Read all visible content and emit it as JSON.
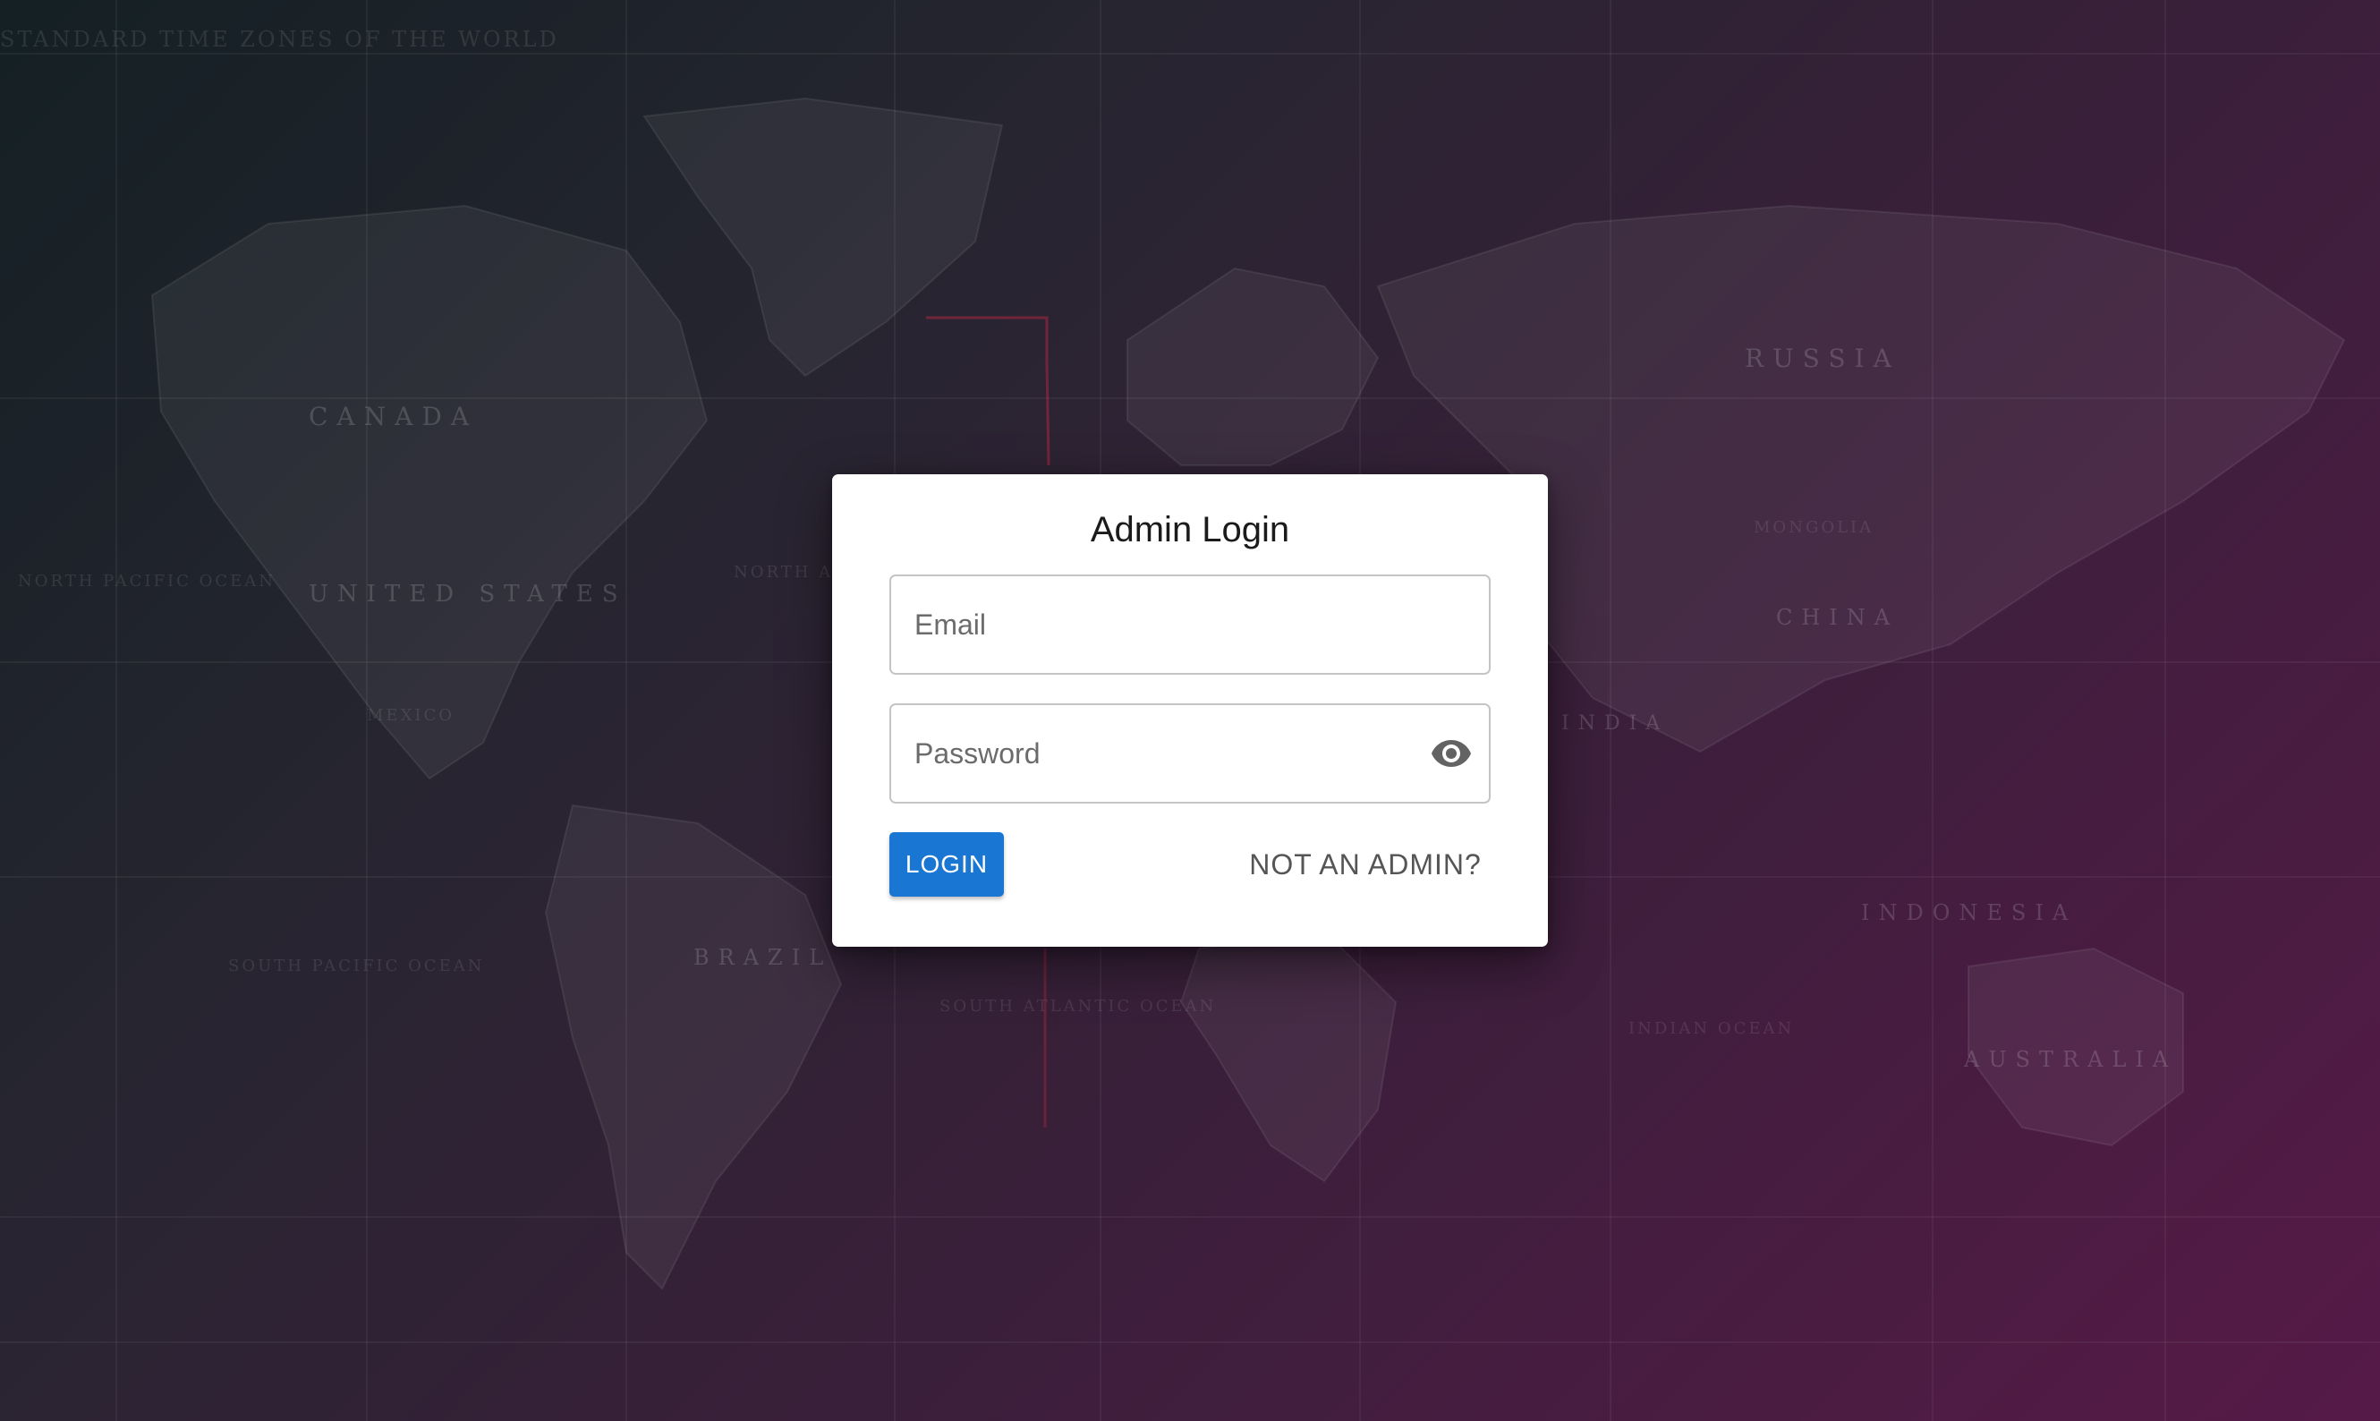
{
  "background": {
    "map_title": "STANDARD TIME ZONES OF THE WORLD",
    "countries": [
      "CANADA",
      "UNITED STATES",
      "BRAZIL",
      "RUSSIA",
      "CHINA",
      "INDIA",
      "INDONESIA",
      "AUSTRALIA",
      "MONGOLIA",
      "MEXICO"
    ],
    "oceans": [
      "NORTH PACIFIC OCEAN",
      "NORTH ATLANTIC OCEAN",
      "SOUTH PACIFIC OCEAN",
      "SOUTH ATLANTIC OCEAN",
      "INDIAN OCEAN"
    ]
  },
  "login": {
    "title": "Admin Login",
    "email_placeholder": "Email",
    "email_value": "",
    "password_placeholder": "Password",
    "password_value": "",
    "toggle_visibility_icon": "eye-icon",
    "login_label": "LOGIN",
    "not_admin_label": "NOT AN ADMIN?"
  },
  "colors": {
    "primary": "#1976d2",
    "card": "#ffffff",
    "background_start": "#142024",
    "background_end": "#561a48"
  }
}
